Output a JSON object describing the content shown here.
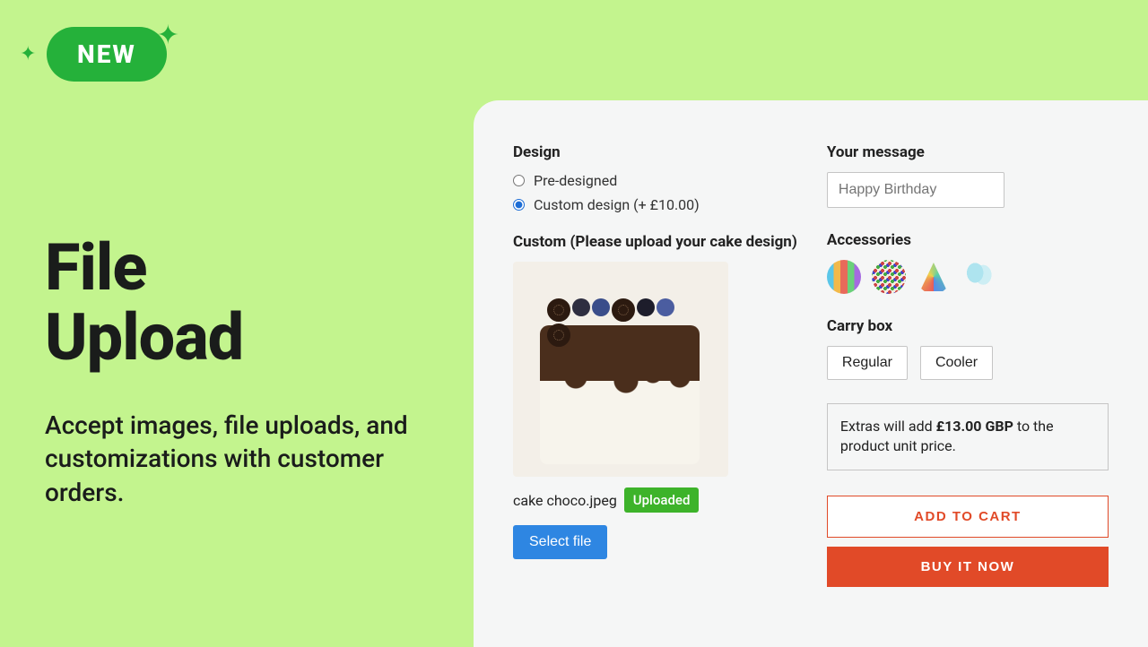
{
  "badge": {
    "text": "NEW"
  },
  "hero": {
    "title_line1": "File",
    "title_line2": "Upload",
    "subtitle": "Accept images, file uploads, and customizations with customer orders."
  },
  "design": {
    "label": "Design",
    "options": [
      {
        "label": "Pre-designed",
        "checked": false
      },
      {
        "label": "Custom design (+ £10.00)",
        "checked": true
      }
    ]
  },
  "custom": {
    "label": "Custom (Please upload your cake design)",
    "filename": "cake choco.jpeg",
    "uploaded_badge": "Uploaded",
    "select_button": "Select file"
  },
  "message": {
    "label": "Your message",
    "placeholder": "Happy Birthday"
  },
  "accessories": {
    "label": "Accessories",
    "items": [
      "candles-icon",
      "sprinkles-icon",
      "party-hat-icon",
      "balloons-icon"
    ]
  },
  "carry": {
    "label": "Carry box",
    "options": [
      "Regular",
      "Cooler"
    ]
  },
  "extras": {
    "prefix": "Extras will add ",
    "amount": "£13.00 GBP",
    "suffix": " to the product unit price."
  },
  "buttons": {
    "add_to_cart": "ADD TO CART",
    "buy_now": "BUY IT NOW"
  }
}
